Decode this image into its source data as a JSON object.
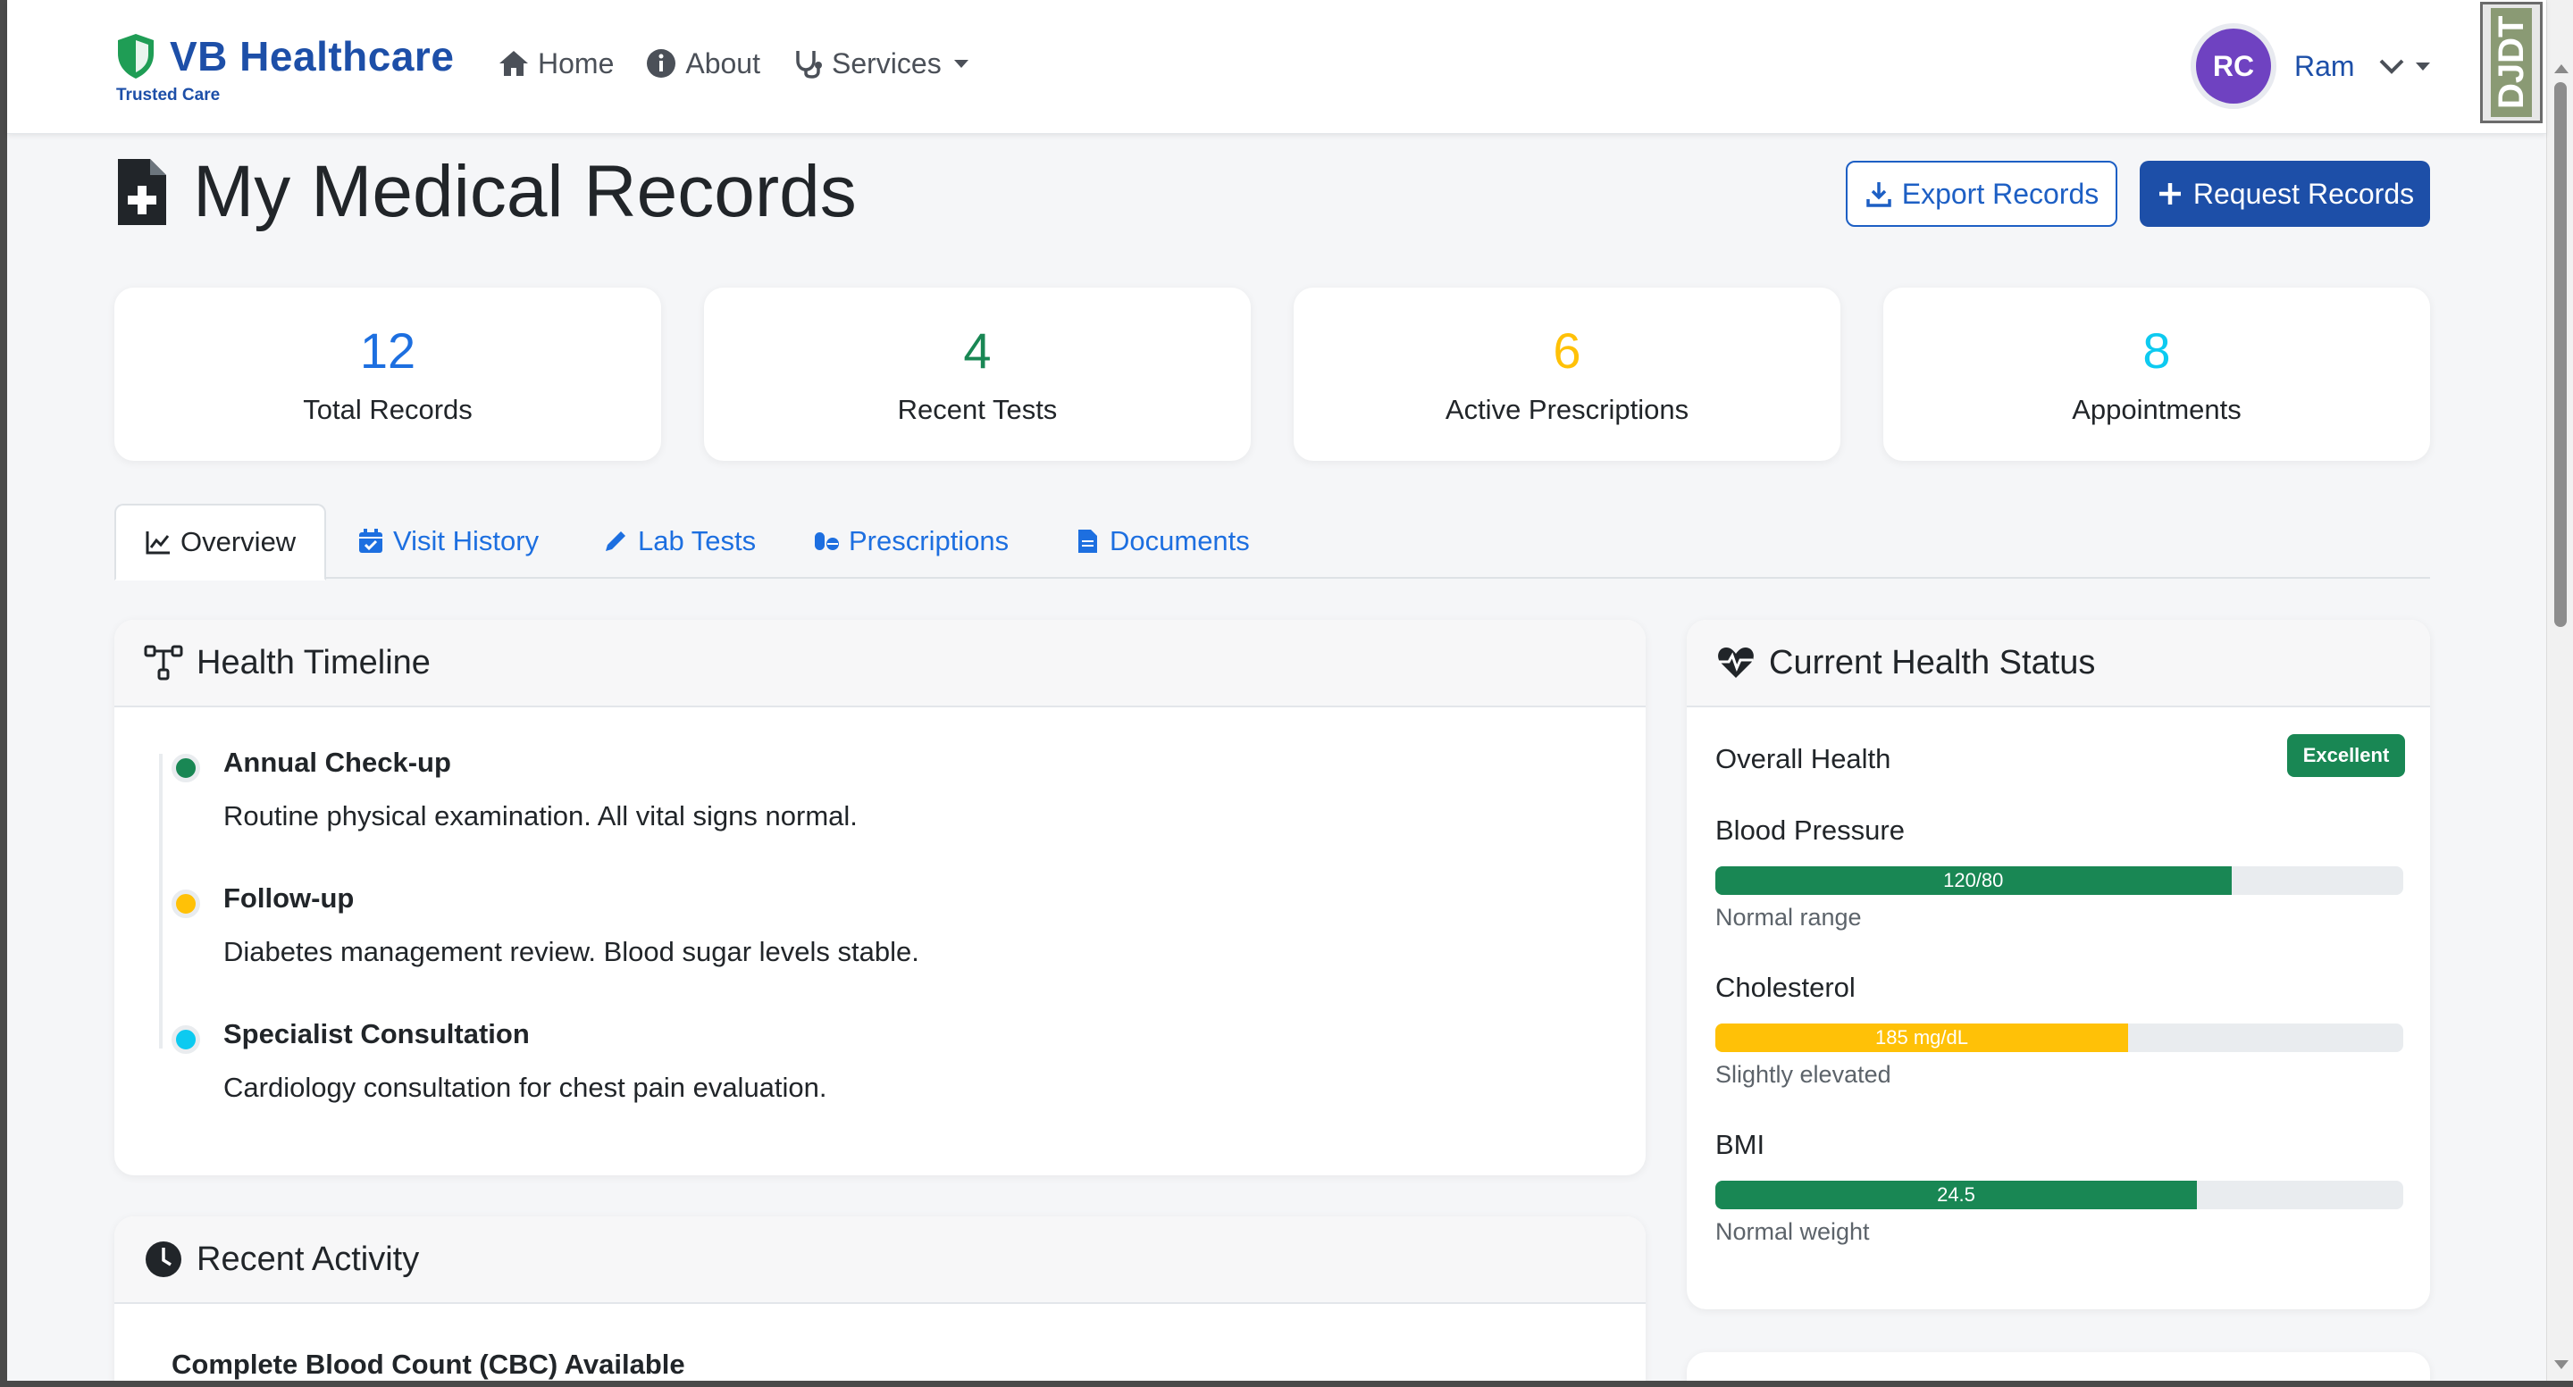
{
  "brand": {
    "name": "VB Healthcare",
    "tagline": "Trusted Care"
  },
  "nav": {
    "home": "Home",
    "about": "About",
    "services": "Services"
  },
  "user": {
    "initials": "RC",
    "name": "Ram"
  },
  "corner_badge": "DJDT",
  "page": {
    "title": "My Medical Records"
  },
  "actions": {
    "export": "Export Records",
    "request": "Request Records"
  },
  "stats": [
    {
      "value": "12",
      "label": "Total Records",
      "color": "#1d6fe0"
    },
    {
      "value": "4",
      "label": "Recent Tests",
      "color": "#198754"
    },
    {
      "value": "6",
      "label": "Active Prescriptions",
      "color": "#ffc107"
    },
    {
      "value": "8",
      "label": "Appointments",
      "color": "#0dcaf0"
    }
  ],
  "tabs": [
    "Overview",
    "Visit History",
    "Lab Tests",
    "Prescriptions",
    "Documents"
  ],
  "timeline": {
    "title": "Health Timeline",
    "items": [
      {
        "title": "Annual Check-up",
        "desc": "Routine physical examination. All vital signs normal.",
        "color": "#198754"
      },
      {
        "title": "Follow-up",
        "desc": "Diabetes management review. Blood sugar levels stable.",
        "color": "#ffc107"
      },
      {
        "title": "Specialist Consultation",
        "desc": "Cardiology consultation for chest pain evaluation.",
        "color": "#0dcaf0"
      }
    ]
  },
  "health_status": {
    "title": "Current Health Status",
    "overall_label": "Overall Health",
    "overall_badge": "Excellent",
    "metrics": [
      {
        "label": "Blood Pressure",
        "value": "120/80",
        "note": "Normal range",
        "fill_percent": 75,
        "color": "#198754"
      },
      {
        "label": "Cholesterol",
        "value": "185 mg/dL",
        "note": "Slightly elevated",
        "fill_percent": 60,
        "color": "#ffc107"
      },
      {
        "label": "BMI",
        "value": "24.5",
        "note": "Normal weight",
        "fill_percent": 70,
        "color": "#198754"
      }
    ]
  },
  "recent_activity": {
    "title": "Recent Activity",
    "first_item": "Complete Blood Count (CBC) Available"
  }
}
